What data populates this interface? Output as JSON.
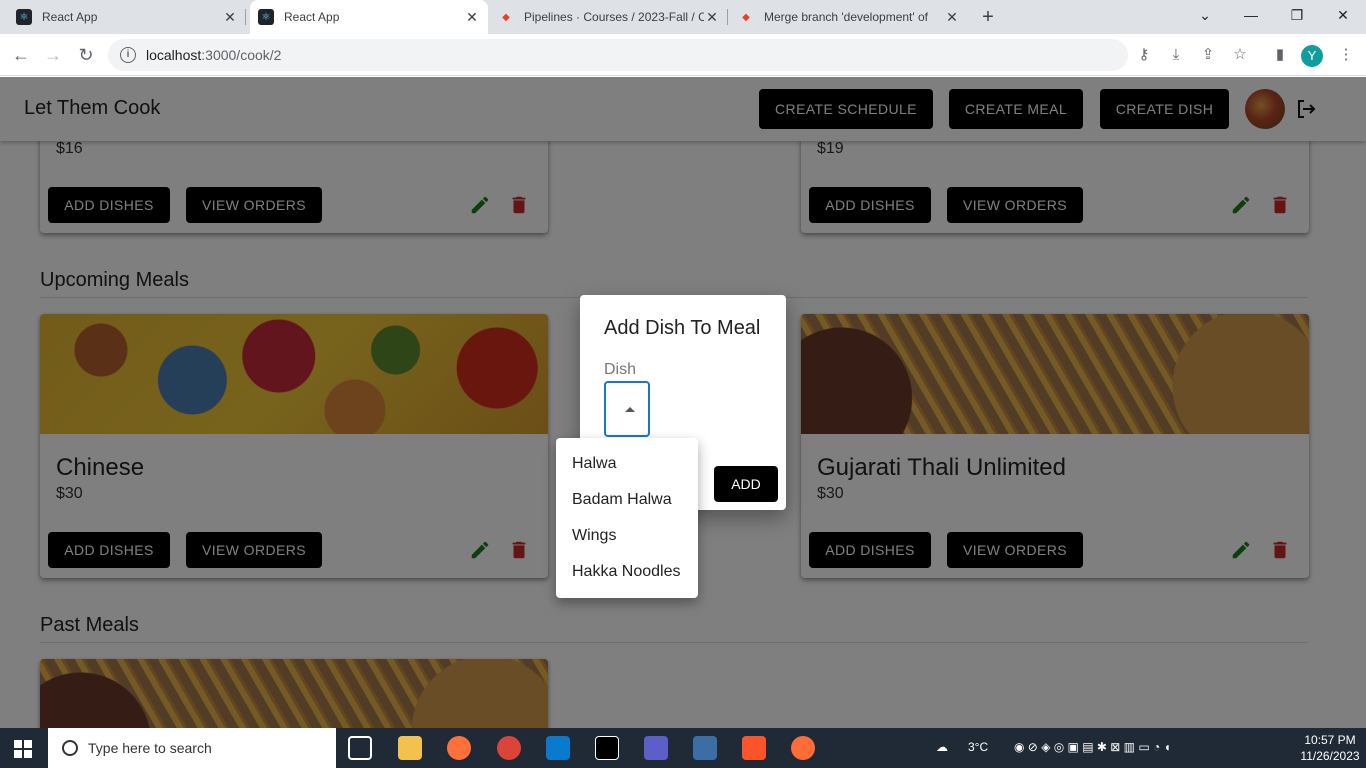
{
  "browser": {
    "tabs": [
      {
        "title": "React App",
        "icon": "react-icon"
      },
      {
        "title": "React App",
        "icon": "react-icon"
      },
      {
        "title": "Pipelines · Courses / 2023-Fall / C",
        "icon": "gitlab-icon"
      },
      {
        "title": "Merge branch 'development' of",
        "icon": "gitlab-icon"
      }
    ],
    "url_host": "localhost",
    "url_path": ":3000/cook/2",
    "profile_initial": "Y"
  },
  "app": {
    "title": "Let Them Cook",
    "create_schedule": "CREATE SCHEDULE",
    "create_meal": "CREATE MEAL",
    "create_dish": "CREATE DISH"
  },
  "top_cards": [
    {
      "price": "$16",
      "add_label": "ADD DISHES",
      "view_label": "VIEW ORDERS"
    },
    {
      "price": "$19",
      "add_label": "ADD DISHES",
      "view_label": "VIEW ORDERS"
    }
  ],
  "sections": {
    "upcoming": "Upcoming Meals",
    "past": "Past Meals"
  },
  "upcoming_cards": [
    {
      "title": "Chinese",
      "price": "$30",
      "add_label": "ADD DISHES",
      "view_label": "VIEW ORDERS"
    },
    {
      "title": "Gujarati Thali Unlimited",
      "price": "$30",
      "add_label": "ADD DISHES",
      "view_label": "VIEW ORDERS"
    }
  ],
  "dialog": {
    "title": "Add Dish To Meal",
    "field_label": "Dish",
    "add_label": "ADD",
    "options": [
      "Halwa",
      "Badam Halwa",
      "Wings",
      "Hakka Noodles"
    ]
  },
  "taskbar": {
    "search_placeholder": "Type here to search",
    "weather": "3°C",
    "time": "10:57 PM",
    "date": "11/26/2023"
  },
  "colors": {
    "accent": "#1976d2",
    "edit": "#1b7d1b",
    "delete": "#c62828",
    "button": "#000000"
  }
}
